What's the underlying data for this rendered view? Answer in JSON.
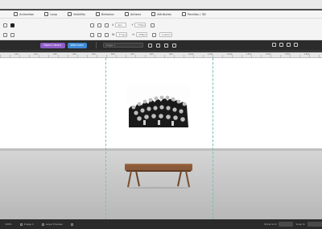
{
  "tabs": [
    {
      "label": "Animation",
      "icon": "animation-icon"
    },
    {
      "label": "Loop",
      "icon": "loop-icon"
    },
    {
      "label": "Visibility",
      "icon": "visibility-icon"
    },
    {
      "label": "Behavior",
      "icon": "behavior-icon"
    },
    {
      "label": "Actions",
      "icon": "actions-icon"
    },
    {
      "label": "Attributes",
      "icon": "attributes-icon"
    },
    {
      "label": "Parallax / 3D",
      "icon": "parallax-icon"
    }
  ],
  "props": {
    "x_label": "X",
    "x_value": "0px",
    "y_label": "Y",
    "y_value": "770px",
    "w_label": "W",
    "w_value": "371px",
    "h_label": "H",
    "h_value": "258px",
    "align_label": "Custom"
  },
  "toolbar": {
    "object_library_label": "Object Library",
    "web_icons_label": "Web Icons",
    "layer_name": "Image 1"
  },
  "ruler": {
    "ticks": [
      "100",
      "200",
      "300",
      "400",
      "500",
      "600",
      "700",
      "800",
      "900",
      "1000",
      "1100",
      "1200",
      "1300",
      "1400",
      "1500",
      "1600"
    ]
  },
  "status": {
    "zoom": "100%",
    "layer_count": "Image 1",
    "layer_preview": "Layer Preview",
    "grid_label": "Show Grid",
    "snap_label": "Snap to"
  },
  "colors": {
    "object_library": "#8e5cc9",
    "web_icons": "#3d8ad6",
    "guide": "#7fb9b9",
    "bench_top": "#8a5a3a"
  }
}
